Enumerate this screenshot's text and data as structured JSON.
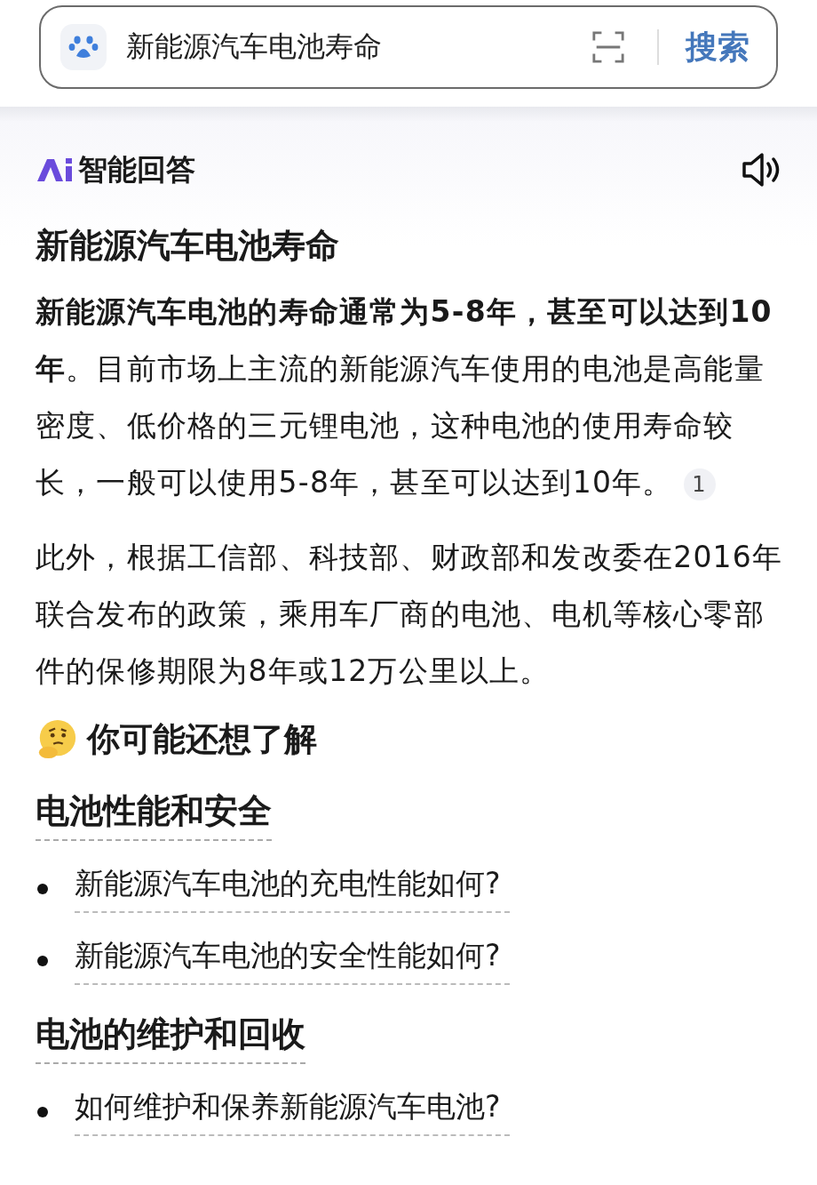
{
  "search": {
    "value": "新能源汽车电池寿命",
    "button": "搜索"
  },
  "answer": {
    "label": "智能回答",
    "title": "新能源汽车电池寿命",
    "paragraphs": [
      {
        "text": "**新能源汽车电池的寿命通常为5-8年，甚至可以达到10年**。目前市场上主流的新能源汽车使用的电池是高能量密度、低价格的三元锂电池，这种电池的使用寿命较长，一般可以使用5-8年，甚至可以达到10年。",
        "citation": "1"
      },
      {
        "text": "此外，根据工信部、科技部、财政部和发改委在2016年联合发布的政策，乘用车厂商的电池、电机等核心零部件的保修期限为8年或12万公里以上。"
      }
    ]
  },
  "related": {
    "heading": "你可能还想了解",
    "groups": [
      {
        "title": "电池性能和安全",
        "questions": [
          "新能源汽车电池的充电性能如何?",
          "新能源汽车电池的安全性能如何?"
        ]
      },
      {
        "title": "电池的维护和回收",
        "questions": [
          "如何维护和保养新能源汽车电池?"
        ]
      }
    ]
  }
}
